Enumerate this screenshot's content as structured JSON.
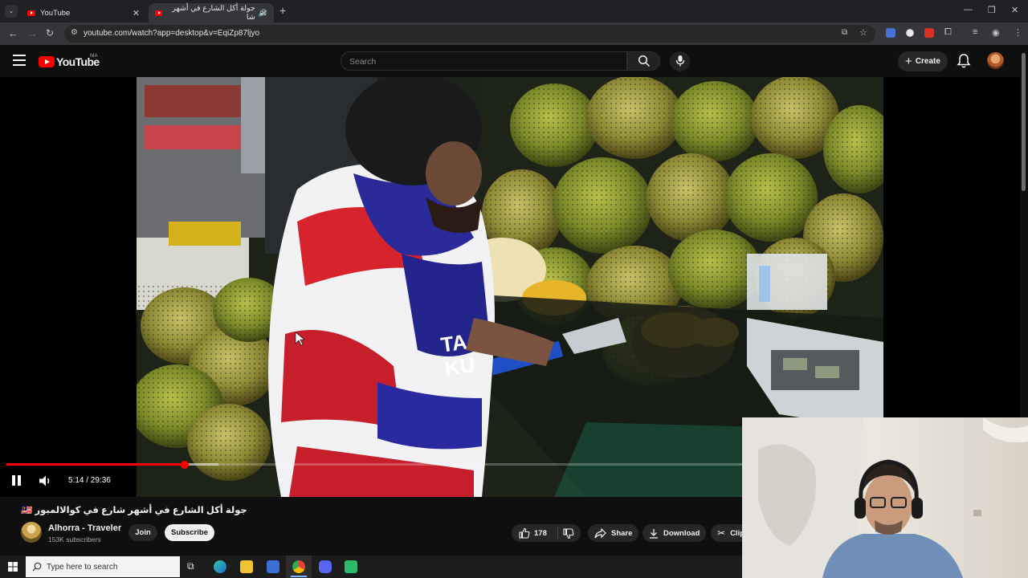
{
  "browser": {
    "tabs": [
      {
        "title": "YouTube",
        "active": false
      },
      {
        "title": "جولة أكل الشارع في أشهر شا",
        "active": true
      }
    ],
    "url": "youtube.com/watch?app=desktop&v=EqiZp87ljyo"
  },
  "header": {
    "logo_text": "YouTube",
    "country_code": "MA",
    "search_placeholder": "Search",
    "create_label": "Create"
  },
  "player": {
    "time_display": "5:14 / 29:36",
    "progress_fraction": 0.177,
    "buffer_fraction": 0.21,
    "playing": true
  },
  "video": {
    "title": "جولة أكل الشارع في أشهر شارع في كوالالمبور 🇲🇾",
    "channel_name": "Alhorra - Traveler",
    "subscribers": "153K subscribers",
    "join_label": "Join",
    "subscribe_label": "Subscribe",
    "like_count": "178",
    "share_label": "Share",
    "download_label": "Download",
    "clip_label": "Clip"
  },
  "taskbar": {
    "search_placeholder": "Type here to search"
  },
  "colors": {
    "youtube_red": "#ff0000",
    "background": "#0f0f0f",
    "pill": "#272727"
  }
}
